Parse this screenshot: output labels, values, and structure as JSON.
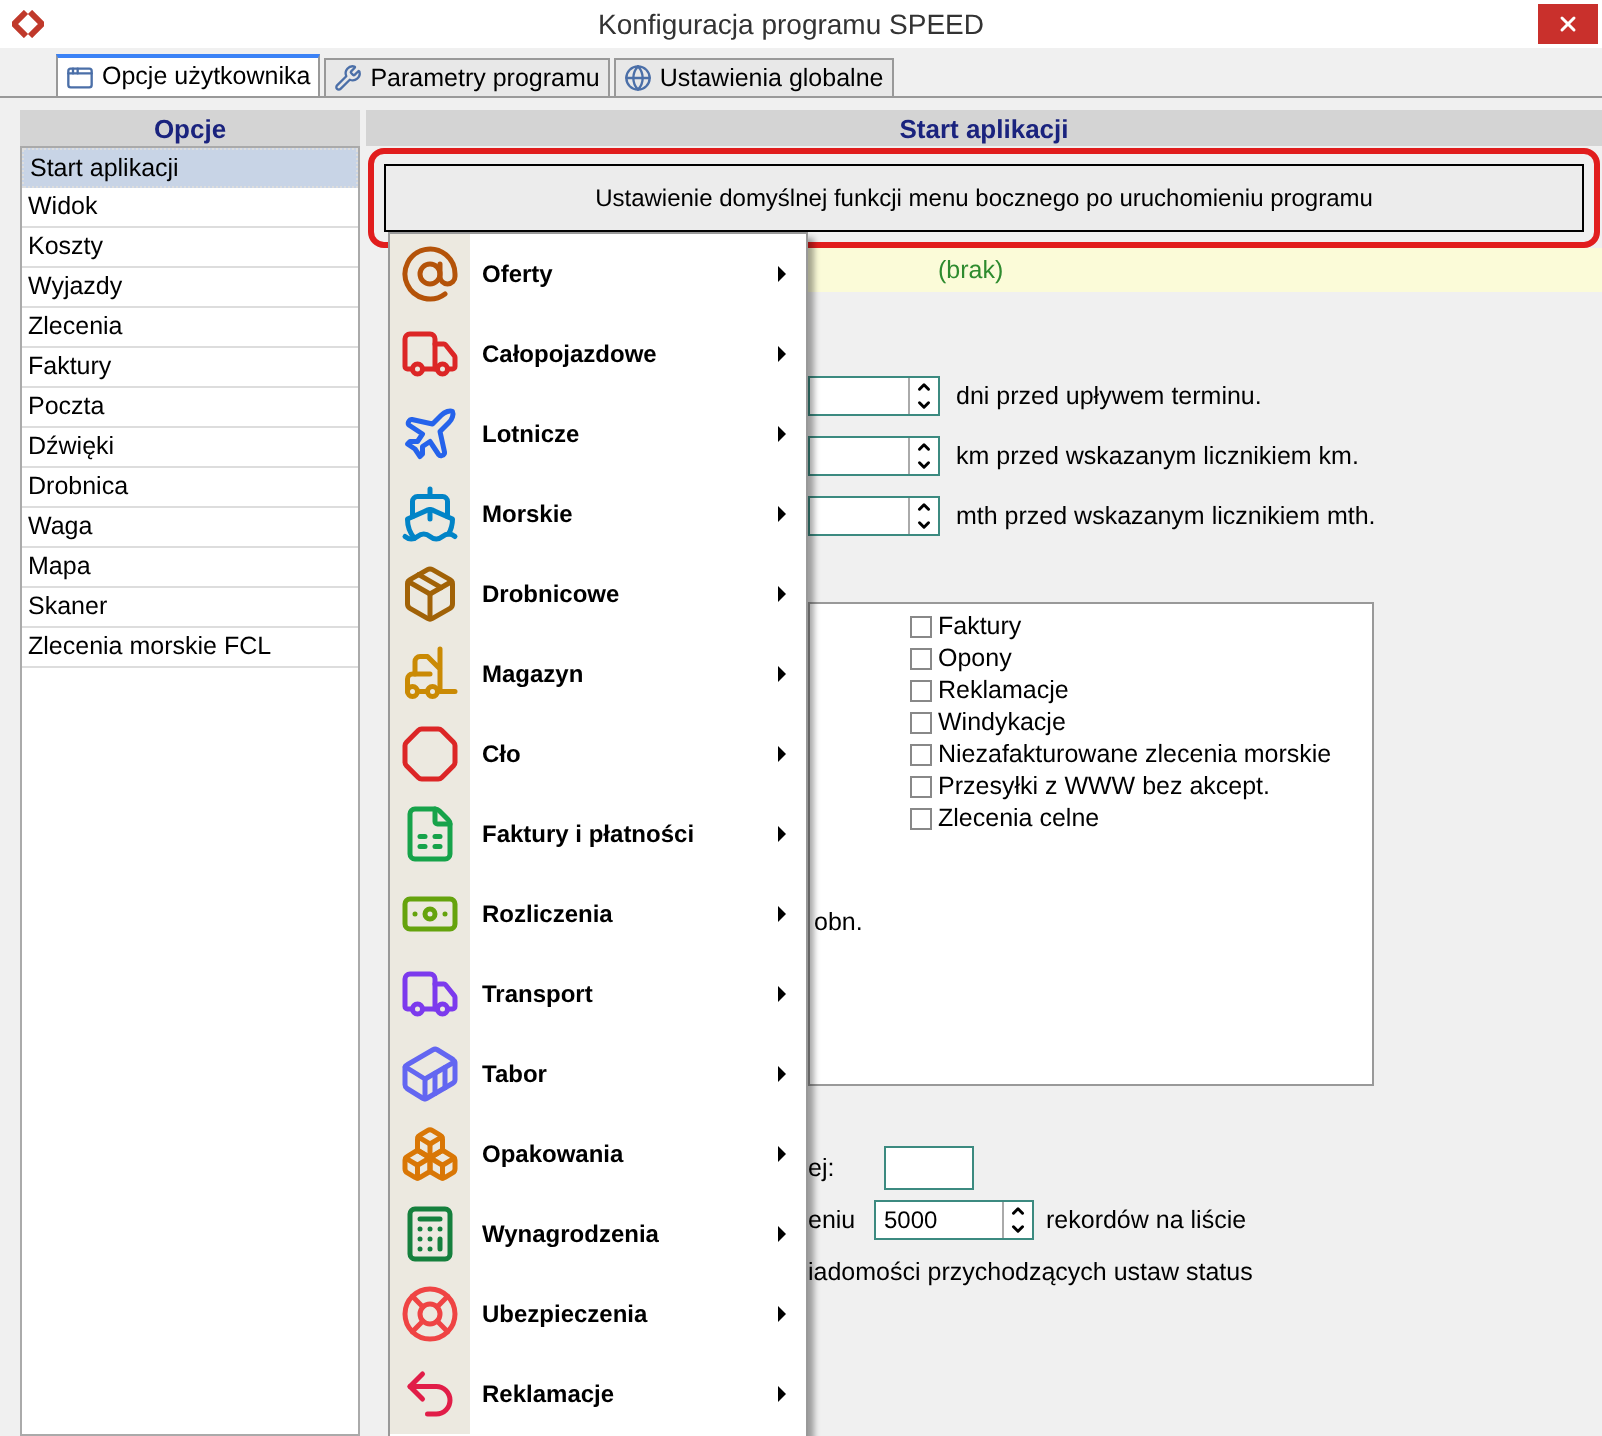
{
  "window": {
    "title": "Konfiguracja programu SPEED"
  },
  "tabs": [
    {
      "label": "Opcje użytkownika",
      "selected": true
    },
    {
      "label": "Parametry programu",
      "selected": false
    },
    {
      "label": "Ustawienia globalne",
      "selected": false
    }
  ],
  "sidebar": {
    "heading": "Opcje",
    "items": [
      {
        "label": "Start aplikacji",
        "selected": true
      },
      {
        "label": "Widok",
        "selected": false
      },
      {
        "label": "Koszty",
        "selected": false
      },
      {
        "label": "Wyjazdy",
        "selected": false
      },
      {
        "label": "Zlecenia",
        "selected": false
      },
      {
        "label": "Faktury",
        "selected": false
      },
      {
        "label": "Poczta",
        "selected": false
      },
      {
        "label": "Dźwięki",
        "selected": false
      },
      {
        "label": "Drobnica",
        "selected": false
      },
      {
        "label": "Waga",
        "selected": false
      },
      {
        "label": "Mapa",
        "selected": false
      },
      {
        "label": "Skaner",
        "selected": false
      },
      {
        "label": "Zlecenia morskie FCL",
        "selected": false
      }
    ]
  },
  "content": {
    "heading": "Start aplikacji",
    "button": "Ustawienie domyślnej funkcji menu bocznego po uruchomieniu programu",
    "current_value": "(brak)",
    "spin_rows": [
      {
        "suffix": "dni przed upływem terminu."
      },
      {
        "suffix": "km przed wskazanym licznikiem km."
      },
      {
        "suffix": "mth przed wskazanym licznikiem mth."
      }
    ],
    "checklist": [
      {
        "label": "Faktury",
        "checked": false
      },
      {
        "label": "Opony",
        "checked": false
      },
      {
        "label": "Reklamacje",
        "checked": false
      },
      {
        "label": "Windykacje",
        "checked": false
      },
      {
        "label": "Niezafakturowane zlecenia morskie",
        "checked": false
      },
      {
        "label": "Przesyłki z WWW bez akcept.",
        "checked": false
      },
      {
        "label": "Zlecenia celne",
        "checked": false
      }
    ],
    "list_fragment": "obn.",
    "field_label": "ej:",
    "records_label": "eniu",
    "records_value": "5000",
    "records_suffix": "rekordów na liście",
    "status_label": "iadomości przychodzących ustaw status"
  },
  "menu": [
    {
      "label": "Oferty"
    },
    {
      "label": "Całopojazdowe"
    },
    {
      "label": "Lotnicze"
    },
    {
      "label": "Morskie"
    },
    {
      "label": "Drobnicowe"
    },
    {
      "label": "Magazyn"
    },
    {
      "label": "Cło"
    },
    {
      "label": "Faktury i płatności"
    },
    {
      "label": "Rozliczenia"
    },
    {
      "label": "Transport"
    },
    {
      "label": "Tabor"
    },
    {
      "label": "Opakowania"
    },
    {
      "label": "Wynagrodzenia"
    },
    {
      "label": "Ubezpieczenia"
    },
    {
      "label": "Reklamacje"
    }
  ]
}
